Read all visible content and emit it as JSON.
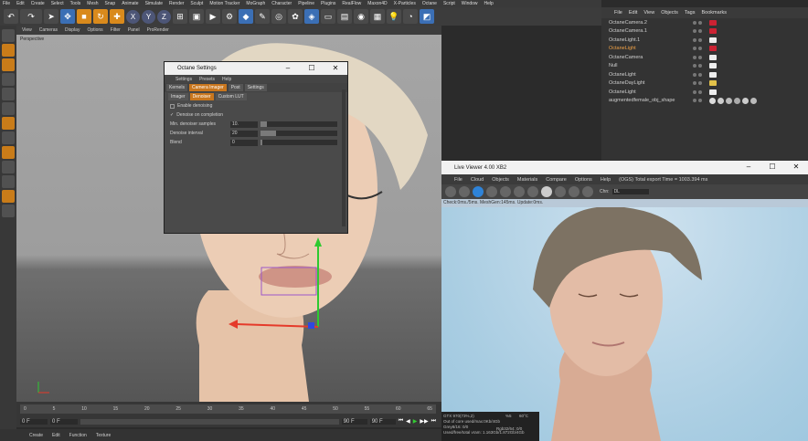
{
  "menubar": [
    "File",
    "Edit",
    "Create",
    "Select",
    "Tools",
    "Mesh",
    "Snap",
    "Animate",
    "Simulate",
    "Render",
    "Sculpt",
    "Motion Tracker",
    "MoGraph",
    "Character",
    "Pipeline",
    "Plugins",
    "RealFlow",
    "Maxon4D",
    "X-Particles",
    "Octane",
    "Script",
    "Window",
    "Help"
  ],
  "viewport": {
    "menu": [
      "View",
      "Cameras",
      "Display",
      "Options",
      "Filter",
      "Panel",
      "ProRender"
    ],
    "label": "Perspective"
  },
  "timeline": {
    "ticks": [
      "0",
      "5",
      "10",
      "15",
      "20",
      "25",
      "30",
      "35",
      "40",
      "45",
      "50",
      "55",
      "60",
      "65"
    ],
    "start_frame": "0 F",
    "current_frame": "0 F",
    "end_frame": "90 F",
    "end_frame2": "90 F"
  },
  "bottombar": [
    "Create",
    "Edit",
    "Function",
    "Texture"
  ],
  "object_manager": {
    "menu": [
      "File",
      "Edit",
      "View",
      "Objects",
      "Tags",
      "Bookmarks"
    ],
    "objects": [
      {
        "name": "OctaneCamera.2",
        "tag": "red",
        "highlight": false
      },
      {
        "name": "OctaneCamera.1",
        "tag": "red",
        "highlight": false
      },
      {
        "name": "OctaneLight.1",
        "tag": "white",
        "highlight": false
      },
      {
        "name": "OctaneLight",
        "tag": "red",
        "highlight": true
      },
      {
        "name": "OctaneCamera",
        "tag": "white",
        "highlight": false
      },
      {
        "name": "Null",
        "tag": "white",
        "highlight": false
      },
      {
        "name": "OctaneLight",
        "tag": "white",
        "highlight": false
      },
      {
        "name": "OctaneDayLight",
        "tag": "yellow",
        "highlight": false
      },
      {
        "name": "OctaneLight",
        "tag": "white",
        "highlight": false
      },
      {
        "name": "augmentedfemale_obj_shape",
        "tag": "white",
        "highlight": false
      }
    ]
  },
  "octane_settings": {
    "title": "Octane Settings",
    "menu": [
      "Settings",
      "Presets",
      "Help"
    ],
    "tabs": [
      "Kernels",
      "Camera Imager",
      "Post",
      "Settings"
    ],
    "subtabs": [
      "Imager",
      "Denoiser",
      "Custom LUT"
    ],
    "enable_denoising": "Enable denoising",
    "denoise_on_completion": "Denoise on completion",
    "fields": [
      {
        "label": "Min. denoiser samples",
        "value": "10.",
        "fill": 0.08
      },
      {
        "label": "Denoise interval",
        "value": "20",
        "fill": 0.2
      },
      {
        "label": "Blend",
        "value": "0",
        "fill": 0.02
      }
    ]
  },
  "live_viewer": {
    "title": "Live Viewer 4.00 XB2",
    "menu": [
      "File",
      "Cloud",
      "Objects",
      "Materials",
      "Compare",
      "Options",
      "Help"
    ],
    "status": "(OGS) Total export Time = 1003.394 ms",
    "channel_label": "Chn:",
    "channel_value": "DL",
    "stats_line": "Check:0ms./5ms. MeshGen:145ms. Update:0ms.",
    "gpu_info": [
      "GTX 970(73%,2)",
      "Out of core used/max:0Kb/4Gb",
      "Grey8/16: 0/0",
      "Used/free/total vram: 1.163Gb/1.872Gb/4Gb"
    ],
    "gpu_info_right": [
      "%5",
      "60°C",
      "Rgb32/64: 0/0"
    ]
  }
}
